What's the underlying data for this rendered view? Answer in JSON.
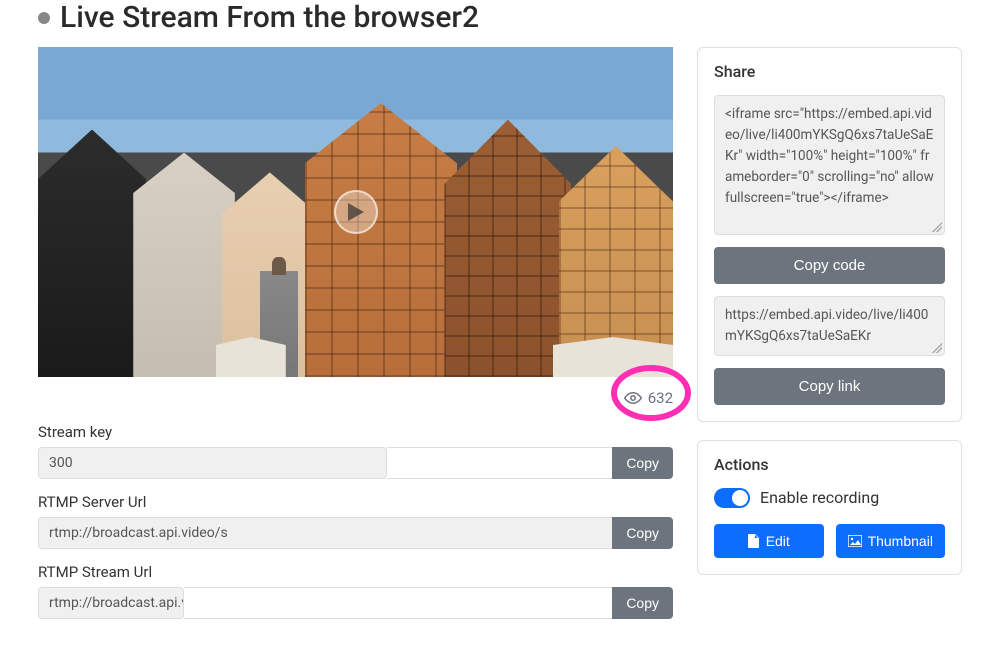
{
  "title": "Live Stream From the browser2",
  "views": "632",
  "fields": {
    "stream_key": {
      "label": "Stream key",
      "value": "300",
      "copy": "Copy"
    },
    "rtmp_server_url": {
      "label": "RTMP Server Url",
      "value": "rtmp://broadcast.api.video/s",
      "copy": "Copy"
    },
    "rtmp_stream_url": {
      "label": "RTMP Stream Url",
      "value": "rtmp://broadcast.api.v",
      "copy": "Copy"
    }
  },
  "share": {
    "heading": "Share",
    "iframe_code": "<iframe src=\"https://embed.api.video/live/li400mYKSgQ6xs7taUeSaEKr\" width=\"100%\" height=\"100%\" frameborder=\"0\" scrolling=\"no\" allowfullscreen=\"true\"></iframe>",
    "copy_code": "Copy code",
    "link": "https://embed.api.video/live/li400mYKSgQ6xs7taUeSaEKr",
    "copy_link": "Copy link"
  },
  "actions": {
    "heading": "Actions",
    "enable_recording": "Enable recording",
    "edit": "Edit",
    "thumbnail": "Thumbnail"
  }
}
